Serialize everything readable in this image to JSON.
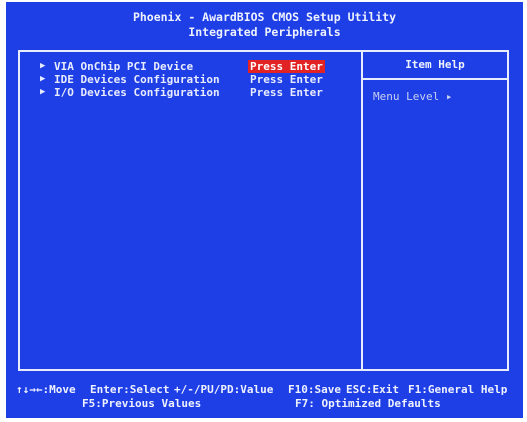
{
  "header": {
    "title": "Phoenix - AwardBIOS CMOS Setup Utility",
    "subtitle": "Integrated Peripherals"
  },
  "menu": {
    "items": [
      {
        "label": "VIA OnChip PCI Device",
        "value": "Press Enter",
        "selected": true
      },
      {
        "label": "IDE Devices Configuration",
        "value": "Press Enter",
        "selected": false
      },
      {
        "label": "I/O Devices Configuration",
        "value": "Press Enter",
        "selected": false
      }
    ]
  },
  "help": {
    "title": "Item Help",
    "menu_level": "Menu Level  ▸"
  },
  "footer": {
    "row1": [
      {
        "key": "↑↓→←:Move"
      },
      {
        "key": "Enter:Select"
      },
      {
        "key": "+/-/PU/PD:Value"
      },
      {
        "key": "F10:Save"
      },
      {
        "key": "ESC:Exit"
      },
      {
        "key": "F1:General Help"
      }
    ],
    "row2": [
      {
        "key": "F5:Previous Values"
      },
      {
        "key": "F7: Optimized Defaults"
      }
    ]
  },
  "colors": {
    "background": "#1f3fe6",
    "text": "#e8ecff",
    "highlight": "#e12323"
  }
}
